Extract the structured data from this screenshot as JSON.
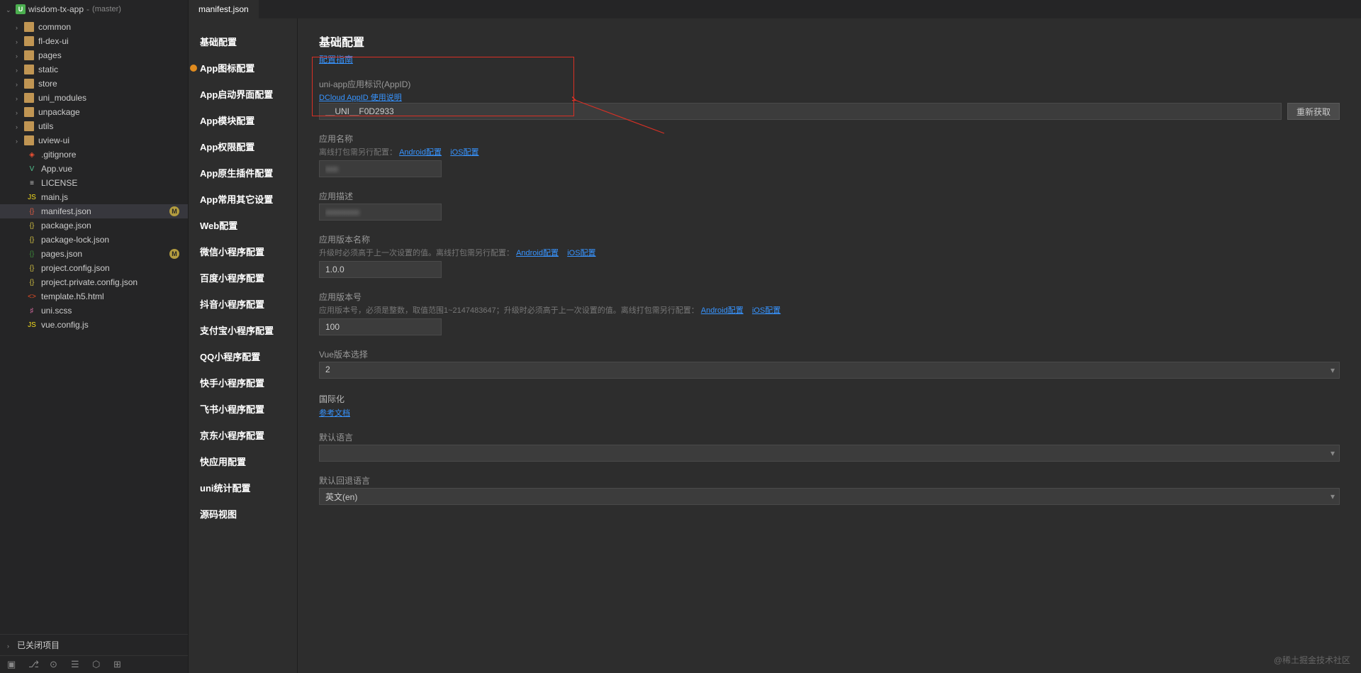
{
  "project": {
    "name": "wisdom-tx-app",
    "branch": "(master)"
  },
  "tree": {
    "folders": [
      "common",
      "fl-dex-ui",
      "pages",
      "static",
      "store",
      "uni_modules",
      "unpackage",
      "utils",
      "uview-ui"
    ],
    "files": [
      {
        "name": ".gitignore",
        "icon": "git"
      },
      {
        "name": "App.vue",
        "icon": "vue"
      },
      {
        "name": "LICENSE",
        "icon": "txt"
      },
      {
        "name": "main.js",
        "icon": "js"
      },
      {
        "name": "manifest.json",
        "icon": "json2",
        "active": true,
        "badge": "M"
      },
      {
        "name": "package.json",
        "icon": "json"
      },
      {
        "name": "package-lock.json",
        "icon": "json"
      },
      {
        "name": "pages.json",
        "icon": "json3",
        "badge": "M"
      },
      {
        "name": "project.config.json",
        "icon": "json"
      },
      {
        "name": "project.private.config.json",
        "icon": "json"
      },
      {
        "name": "template.h5.html",
        "icon": "html"
      },
      {
        "name": "uni.scss",
        "icon": "scss"
      },
      {
        "name": "vue.config.js",
        "icon": "js"
      }
    ]
  },
  "closed_projects": "已关闭项目",
  "active_tab": "manifest.json",
  "nav": [
    {
      "label": "基础配置"
    },
    {
      "label": "App图标配置",
      "warn": true
    },
    {
      "label": "App启动界面配置"
    },
    {
      "label": "App模块配置"
    },
    {
      "label": "App权限配置"
    },
    {
      "label": "App原生插件配置"
    },
    {
      "label": "App常用其它设置"
    },
    {
      "label": "Web配置"
    },
    {
      "label": "微信小程序配置"
    },
    {
      "label": "百度小程序配置"
    },
    {
      "label": "抖音小程序配置"
    },
    {
      "label": "支付宝小程序配置"
    },
    {
      "label": "QQ小程序配置"
    },
    {
      "label": "快手小程序配置"
    },
    {
      "label": "飞书小程序配置"
    },
    {
      "label": "京东小程序配置"
    },
    {
      "label": "快应用配置"
    },
    {
      "label": "uni统计配置"
    },
    {
      "label": "源码视图"
    }
  ],
  "page": {
    "title": "基础配置",
    "guide_link": "配置指南",
    "appid_label": "uni-app应用标识(AppID)",
    "appid_help": "DCloud AppID 使用说明",
    "appid_value": "__UNI__F0D2933",
    "refetch_btn": "重新获取",
    "appname_label": "应用名称",
    "appname_help": "离线打包需另行配置：",
    "android_link": "Android配置",
    "ios_link": "iOS配置",
    "appname_value": "xxx",
    "appdesc_label": "应用描述",
    "appdesc_value": "xxxxxxxx",
    "vername_label": "应用版本名称",
    "vername_help": "升级时必须高于上一次设置的值。离线打包需另行配置：",
    "vername_value": "1.0.0",
    "vercode_label": "应用版本号",
    "vercode_help": "应用版本号，必须是整数，取值范围1~2147483647；升级时必须高于上一次设置的值。离线打包需另行配置：",
    "vercode_value": "100",
    "vuever_label": "Vue版本选择",
    "vuever_value": "2",
    "i18n_title": "国际化",
    "i18n_ref": "参考文档",
    "deflang_label": "默认语言",
    "deflang_value": "",
    "fallback_label": "默认回退语言",
    "fallback_value": "英文(en)"
  },
  "watermark": "@稀土掘金技术社区"
}
